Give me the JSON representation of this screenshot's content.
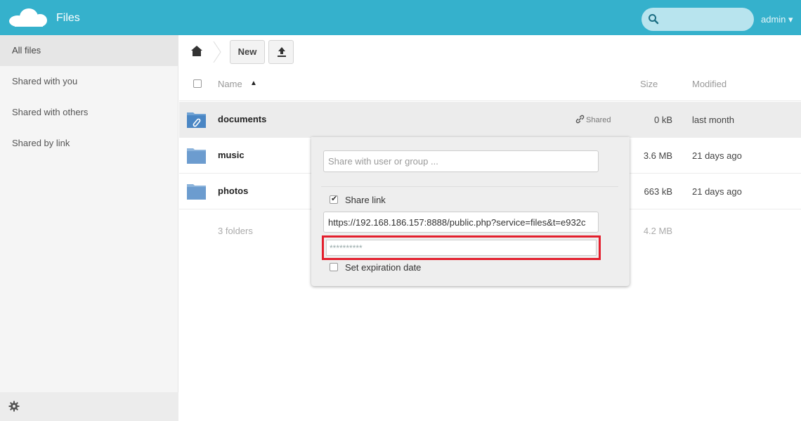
{
  "header": {
    "app_title": "Files",
    "search_value": "",
    "user_label": "admin ▾",
    "accent_color": "#35b1cc"
  },
  "sidebar": {
    "items": [
      {
        "label": "All files",
        "active": true
      },
      {
        "label": "Shared with you",
        "active": false
      },
      {
        "label": "Shared with others",
        "active": false
      },
      {
        "label": "Shared by link",
        "active": false
      }
    ],
    "settings_icon": "gear-icon"
  },
  "controls": {
    "home_icon": "home-icon",
    "new_label": "New",
    "upload_icon": "upload-icon"
  },
  "table": {
    "columns": {
      "name": "Name",
      "size": "Size",
      "modified": "Modified"
    },
    "sort_indicator": "▲",
    "rows": [
      {
        "name": "documents",
        "shared_label": "Shared",
        "size": "0 kB",
        "modified": "last month",
        "selected": true
      },
      {
        "name": "music",
        "size": "3.6 MB",
        "modified": "21 days ago",
        "selected": false
      },
      {
        "name": "photos",
        "size": "663 kB",
        "modified": "21 days ago",
        "selected": false
      }
    ],
    "summary": {
      "count": "3 folders",
      "size": "4.2 MB"
    }
  },
  "share_dropdown": {
    "share_with_placeholder": "Share with user or group ...",
    "share_link_label": "Share link",
    "share_link_checked": true,
    "link_url": "https://192.168.186.157:8888/public.php?service=files&t=e932c",
    "password_placeholder": "**********",
    "expiration_label": "Set expiration date",
    "expiration_checked": false,
    "highlight_color": "#e31f2d"
  }
}
